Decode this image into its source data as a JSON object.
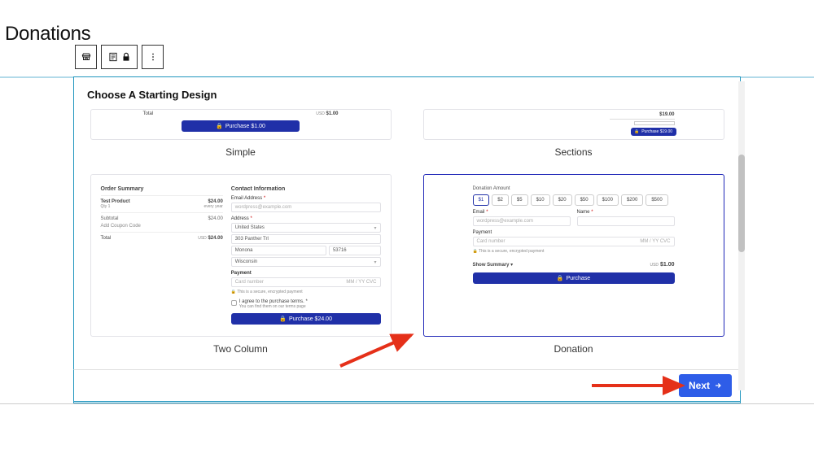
{
  "page_title": "Donations",
  "modal_title": "Choose A Starting Design",
  "designs": {
    "simple": {
      "name": "Simple",
      "total_label": "Total",
      "currency": "USD",
      "price": "$1.00",
      "button": "Purchase $1.00"
    },
    "sections": {
      "name": "Sections",
      "price": "$19.00",
      "button": "Purchase $19.00"
    },
    "two_column": {
      "name": "Two Column",
      "summary_title": "Order Summary",
      "contact_title": "Contact Information",
      "product": "Test Product",
      "qty_label": "Qty 1",
      "product_price": "$24.00",
      "product_sub": "every year",
      "subtotal_label": "Subtotal",
      "subtotal_price": "$24.00",
      "coupon_label": "Add Coupon Code",
      "total_label": "Total",
      "currency": "USD",
      "total_price": "$24.00",
      "email_label": "Email Address",
      "email_placeholder": "wordpress@example.com",
      "address_label": "Address",
      "country": "United States",
      "street": "303 Panther Trl",
      "city": "Monona",
      "zip": "53716",
      "state": "Wisconsin",
      "payment_label": "Payment",
      "card_placeholder": "Card number",
      "card_extra": "MM / YY  CVC",
      "secure_note": "This is a secure, encrypted payment",
      "terms": "I agree to the purchase terms.",
      "terms_sub": "You can find them on our terms page",
      "button": "Purchase $24.00"
    },
    "donation": {
      "name": "Donation",
      "amount_label": "Donation Amount",
      "amounts": [
        "$1",
        "$2",
        "$5",
        "$10",
        "$20",
        "$50",
        "$100",
        "$200",
        "$500"
      ],
      "selected_amount": "$1",
      "email_label": "Email",
      "name_label": "Name",
      "email_placeholder": "wordpress@example.com",
      "payment_label": "Payment",
      "card_placeholder": "Card number",
      "card_extra": "MM / YY  CVC",
      "secure_note": "This is a secure, encrypted payment",
      "summary_label": "Show Summary",
      "currency": "USD",
      "price": "$1.00",
      "button": "Purchase"
    }
  },
  "footer": {
    "next_label": "Next"
  },
  "colors": {
    "primary_btn": "#2E5DE8",
    "thumb_btn": "#2030a8",
    "border_accent": "#2196bf",
    "arrow": "#E53019"
  }
}
